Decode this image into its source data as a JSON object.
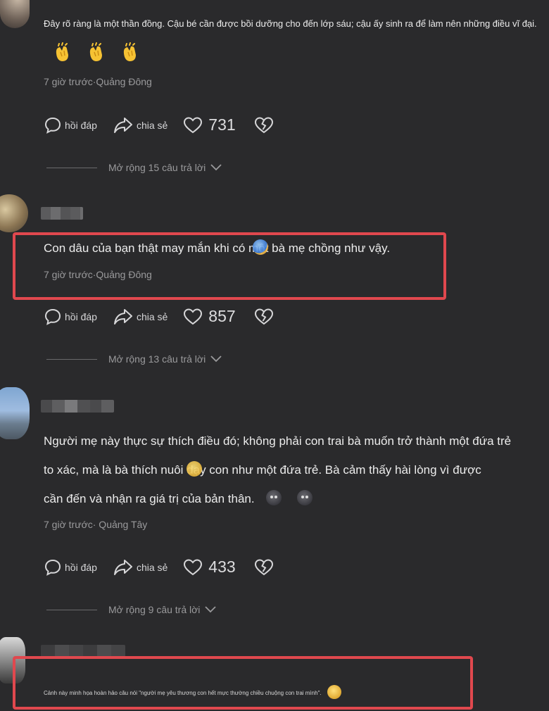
{
  "colors": {
    "background": "#2a2a2c",
    "text": "#ececec",
    "meta": "#9a9a9c",
    "highlight": "#e0484e"
  },
  "icons": [
    "reply-bubble-icon",
    "share-arrow-icon",
    "heart-icon",
    "broken-heart-icon",
    "chevron-down-icon",
    "clapping-hands-icon"
  ],
  "comments": [
    {
      "text": "Đây rõ ràng là một thần đồng. Cậu bé cần được bồi dưỡng cho đến lớp sáu; cậu ấy sinh ra để làm nên những điều vĩ đại.",
      "meta": "7 giờ trước·Quảng Đông",
      "reply_label": "hồi đáp",
      "share_label": "chia sẻ",
      "likes": "731",
      "expand_label": "Mở rộng 15 câu trả lời"
    },
    {
      "text_part1": "Con dâu của bạn thật may mắn khi có m",
      "text_part2": "ột bà mẹ chồng như vậy.",
      "meta": "7 giờ trước·Quảng Đông",
      "reply_label": "hồi đáp",
      "share_label": "chia sẻ",
      "likes": "857",
      "expand_label": "Mở rộng 13 câu trả lời"
    },
    {
      "line1": "Người mẹ này thực sự thích điều đó; không phải con trai bà muốn trở thành một đứa trẻ",
      "line2a": "to xác, mà là bà thích nuôi d",
      "line2b": "ạy con như một đứa trẻ. Bà cảm thấy hài lòng vì được",
      "line3": "cần đến và nhận ra giá trị của bản thân.",
      "meta": "7 giờ trước· Quảng Tây",
      "reply_label": "hồi đáp",
      "share_label": "chia sẻ",
      "likes": "433",
      "expand_label": "Mở rộng 9 câu trả lời"
    },
    {
      "text": "Cảnh này minh họa hoàn hảo câu nói \"người mẹ yêu thương con hết mực thường chiều chuộng con trai mình\"."
    }
  ]
}
